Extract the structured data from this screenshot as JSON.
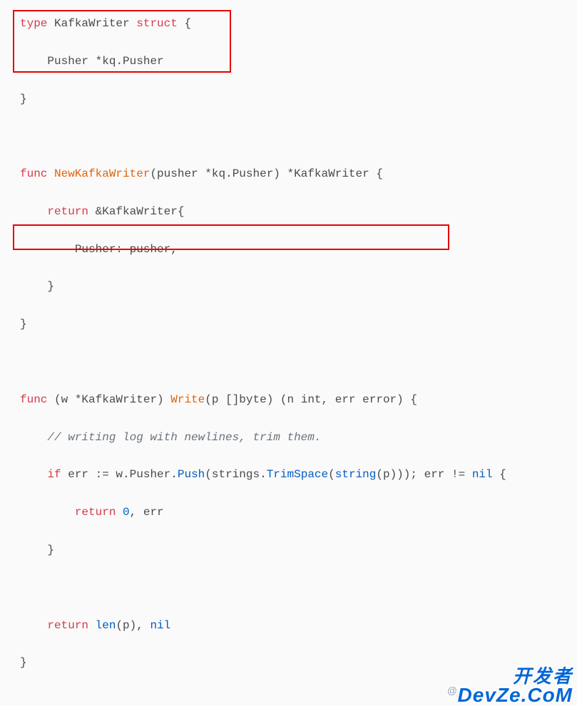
{
  "code": {
    "l1": {
      "kw1": "type",
      "name": "KafkaWriter",
      "kw2": "struct",
      "brace": "{"
    },
    "l2": {
      "field": "Pusher",
      "star": "*",
      "pkg": "kq",
      "dot": ".",
      "typ": "Pusher"
    },
    "l3": {
      "brace": "}"
    },
    "l5": {
      "kw": "func",
      "name": "NewKafkaWriter",
      "lp": "(",
      "arg": "pusher",
      "star": "*",
      "pkg": "kq",
      "dot": ".",
      "typ": "Pusher",
      "rp": ")",
      "retstar": " *",
      "rettyp": "KafkaWriter",
      "brace": " {"
    },
    "l6": {
      "kw": "return",
      "amp": " &",
      "typ": "KafkaWriter",
      "brace": "{"
    },
    "l7": {
      "field": "Pusher",
      "colon": ":",
      "val": " pusher",
      "comma": ","
    },
    "l8": {
      "brace": "}"
    },
    "l9": {
      "brace": "}"
    },
    "l11": {
      "kw": "func",
      "lp": " (",
      "recv": "w",
      "star": " *",
      "typ": "KafkaWriter",
      "rp": ") ",
      "name": "Write",
      "lp2": "(",
      "arg": "p",
      "argtype": " []byte",
      "rp2": ")",
      "ret": " (n int, err error) ",
      "brace": "{"
    },
    "l12": {
      "comment": "// writing log with newlines, trim them."
    },
    "l13": {
      "kw1": "if",
      "err": " err ",
      "assign": ":=",
      "recv": " w",
      "dot1": ".",
      "pusher": "Pusher",
      "dot2": ".",
      "push": "Push",
      "lp": "(",
      "strings": "strings",
      "dot3": ".",
      "trim": "TrimSpace",
      "lp2": "(",
      "cast": "string",
      "lp3": "(",
      "p": "p",
      "rp3": ")",
      "rp2": ")",
      "rp": ")",
      "semi": "; ",
      "err2": "err",
      "neq": " != ",
      "nil": "nil",
      "brace": " {"
    },
    "l14": {
      "kw": "return",
      "zero": " 0",
      "comma": ",",
      "err": " err"
    },
    "l15": {
      "brace": "}"
    },
    "l17": {
      "kw": "return",
      "sp": " ",
      "len": "len",
      "lp": "(",
      "p": "p",
      "rp": ")",
      "comma": ", ",
      "nil": "nil"
    },
    "l18": {
      "brace": "}"
    }
  },
  "watermark": {
    "line1": "开发者",
    "at": "@",
    "line2": "DevZe.CoM"
  }
}
